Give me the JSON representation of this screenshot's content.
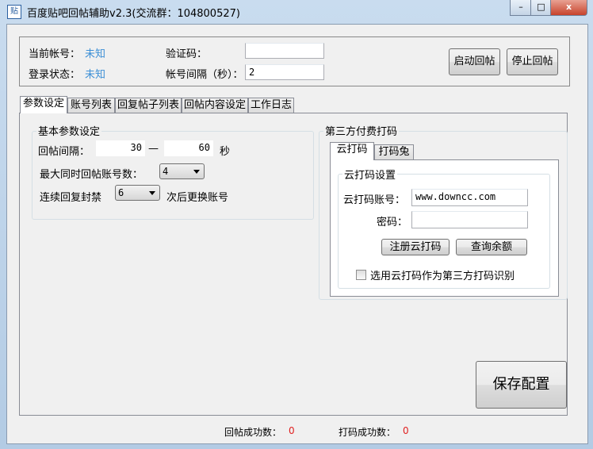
{
  "window": {
    "title": "百度贴吧回帖辅助v2.3(交流群：104800527)",
    "icon": "贴",
    "minimize": "–",
    "maximize": "□",
    "close": "x"
  },
  "top": {
    "current_account_label": "当前帐号：",
    "current_account_value": "未知",
    "login_status_label": "登录状态：",
    "login_status_value": "未知",
    "captcha_label": "验证码：",
    "captcha_value": "",
    "interval_label": "帐号间隔（秒）：",
    "interval_value": "2",
    "start_button": "启动回帖",
    "stop_button": "停止回帖"
  },
  "tabs": [
    "参数设定",
    "账号列表",
    "回复帖子列表",
    "回帖内容设定",
    "工作日志"
  ],
  "basic": {
    "title": "基本参数设定",
    "reply_interval_label": "回帖间隔：",
    "interval_min": "30",
    "dash": "—",
    "interval_max": "60",
    "seconds": "秒",
    "max_accounts_label": "最大同时回帖账号数：",
    "max_accounts_value": "4",
    "ban_label": "连续回复封禁",
    "ban_value": "6",
    "ban_suffix": "次后更换账号"
  },
  "third": {
    "title": "第三方付费打码",
    "tabs": [
      "云打码",
      "打码兔"
    ],
    "group_title": "云打码设置",
    "account_label": "云打码账号：",
    "account_value": "www.downcc.com",
    "password_label": "密码：",
    "password_value": "",
    "register_button": "注册云打码",
    "query_button": "查询余额",
    "use_checkbox": "选用云打码作为第三方打码识别",
    "use_checked": false
  },
  "save_button": "保存配置",
  "status": {
    "reply_success_label": "回帖成功数：",
    "reply_success_value": "0",
    "captcha_success_label": "打码成功数：",
    "captcha_success_value": "0"
  }
}
